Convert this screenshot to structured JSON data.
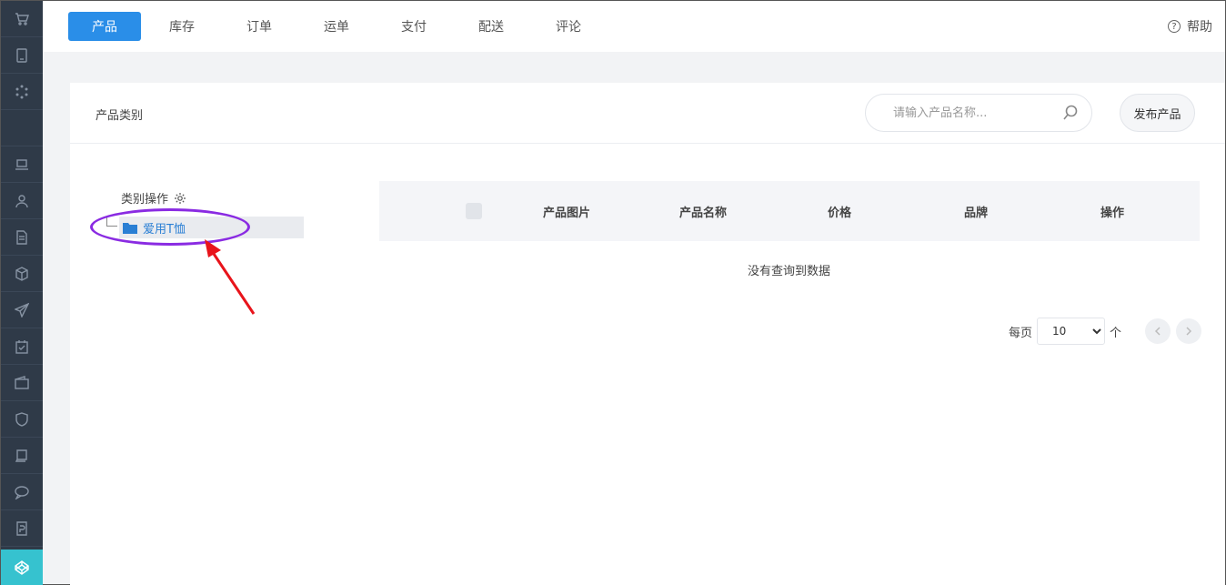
{
  "rail": {
    "icons": [
      "cart-icon",
      "tablet-icon",
      "loading-icon",
      "laptop-icon",
      "user-icon",
      "document-icon",
      "cube-icon",
      "send-icon",
      "calendar-check-icon",
      "wallet-icon",
      "shield-icon",
      "book-icon",
      "chat-icon",
      "price-tag-icon",
      "codepen-icon"
    ]
  },
  "nav": {
    "tabs": [
      "产品",
      "库存",
      "订单",
      "运单",
      "支付",
      "配送",
      "评论"
    ],
    "active_tab": "产品",
    "help_label": "帮助"
  },
  "panel": {
    "title": "产品类别",
    "search_placeholder": "请输入产品名称...",
    "publish_label": "发布产品"
  },
  "tree": {
    "header": "类别操作",
    "items": [
      "爱用T恤"
    ]
  },
  "table": {
    "columns": [
      "产品图片",
      "产品名称",
      "价格",
      "品牌",
      "操作"
    ],
    "empty_text": "没有查询到数据"
  },
  "pager": {
    "per_page_label": "每页",
    "page_size": "10",
    "unit_label": "个"
  },
  "colors": {
    "accent": "#2a8ee8",
    "rail_bg": "#2f3a48",
    "rail_active": "#36c2cf",
    "annotation_ellipse": "#8a2be2",
    "annotation_arrow": "#e8141b"
  }
}
